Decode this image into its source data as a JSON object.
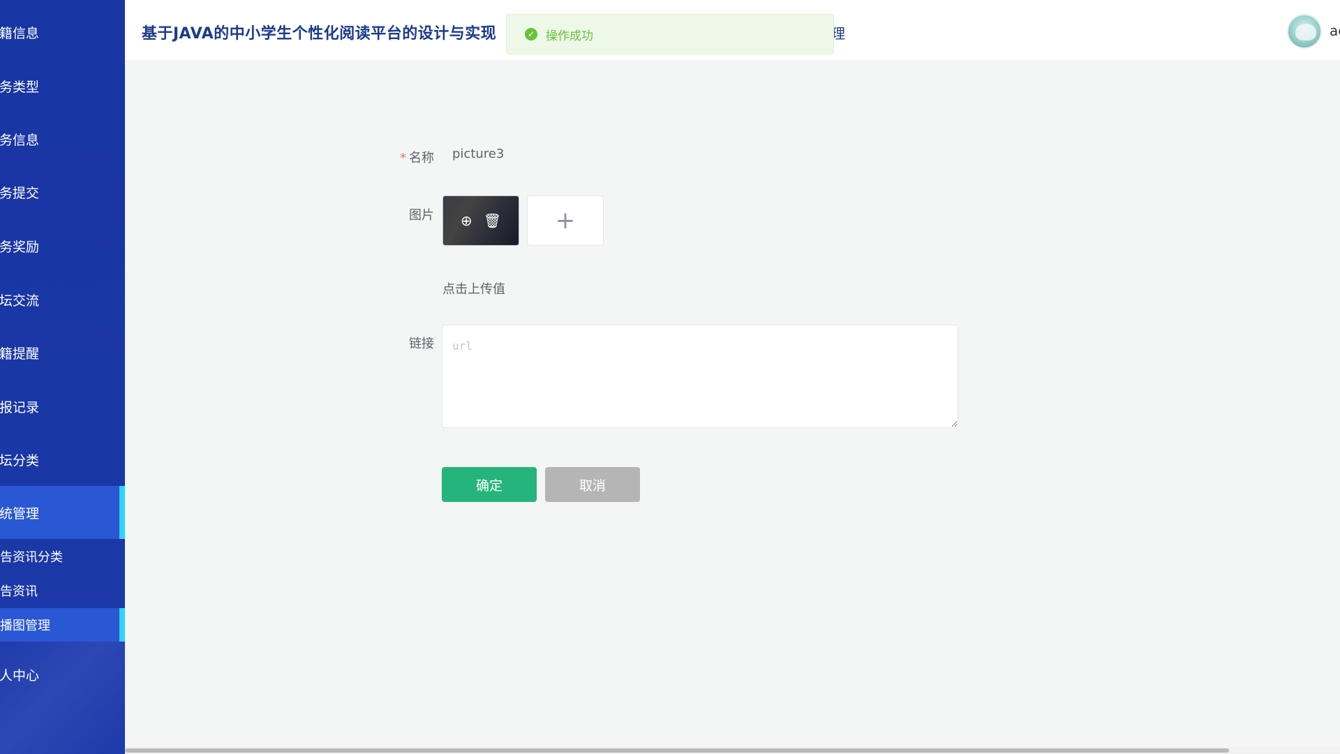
{
  "app": {
    "title": "基于JAVA的中小学生个性化阅读平台的设计与实现",
    "header_tail": "理",
    "user_name": "ac"
  },
  "sidebar": {
    "items": [
      {
        "label": "籍信息",
        "active": false
      },
      {
        "label": "务类型",
        "active": false
      },
      {
        "label": "务信息",
        "active": false
      },
      {
        "label": "务提交",
        "active": false
      },
      {
        "label": "务奖励",
        "active": false
      },
      {
        "label": "坛交流",
        "active": false
      },
      {
        "label": "籍提醒",
        "active": false
      },
      {
        "label": "报记录",
        "active": false
      },
      {
        "label": "坛分类",
        "active": false
      },
      {
        "label": "统管理",
        "active": true
      }
    ],
    "sub_items": [
      {
        "label": "告资讯分类",
        "active": false
      },
      {
        "label": "告资讯",
        "active": false
      },
      {
        "label": "播图管理",
        "active": true
      }
    ],
    "bottom_item": {
      "label": "人中心"
    }
  },
  "toast": {
    "message": "操作成功",
    "icon": "check-circle-icon"
  },
  "form": {
    "name_label": "名称",
    "name_value": "picture3",
    "image_label": "图片",
    "upload_hint": "点击上传值",
    "link_label": "链接",
    "link_placeholder": "url",
    "link_value": "",
    "confirm_label": "确定",
    "cancel_label": "取消"
  },
  "colors": {
    "sidebar_bg": "#1a37a6",
    "active_item_bg": "#2a57d4",
    "active_indicator": "#2ed3ff",
    "confirm": "#26b47d",
    "cancel": "#b5b5b5",
    "toast_text": "#67c23a"
  }
}
